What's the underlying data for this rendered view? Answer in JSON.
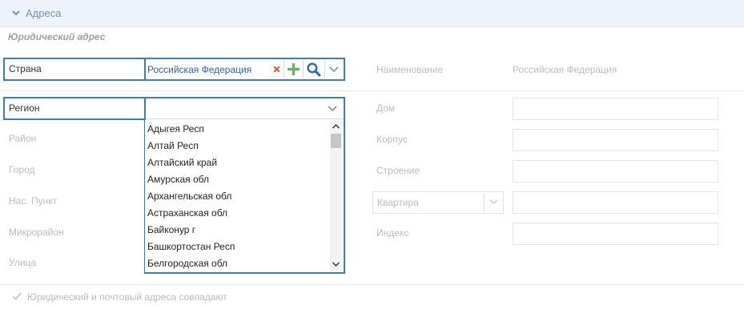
{
  "section": {
    "title": "Адреса"
  },
  "subtitle": "Юридический адрес",
  "left_fields": {
    "country_label": "Страна",
    "country_value": "Российская Федерация",
    "region_label": "Регион",
    "district_label": "Район",
    "city_label": "Город",
    "locality_label": "Нас. Пункт",
    "microdistrict_label": "Микрорайон",
    "street_label": "Улица"
  },
  "right_fields": {
    "name_label": "Наименование",
    "name_value": "Российская Федерация",
    "house_label": "Дом",
    "building_label": "Корпус",
    "structure_label": "Строение",
    "apartment_select": "Квартира",
    "index_label": "Индекс"
  },
  "region_options": [
    "Адыгея Респ",
    "Алтай Респ",
    "Алтайский край",
    "Амурская обл",
    "Архангельская обл",
    "Астраханская обл",
    "Байконур г",
    "Башкортостан Респ",
    "Белгородская обл"
  ],
  "checkbox": {
    "label": "Юридический и почтовый адреса совпадают",
    "checked": true
  },
  "icons": {
    "clear": "close-icon",
    "add": "plus-icon",
    "search": "search-icon",
    "expand": "chevron-down-icon"
  },
  "colors": {
    "highlight": "#3c7fb1",
    "clear": "#e8542c",
    "add": "#5db84a",
    "search": "#2f6db3",
    "link": "#2f5fb3"
  }
}
